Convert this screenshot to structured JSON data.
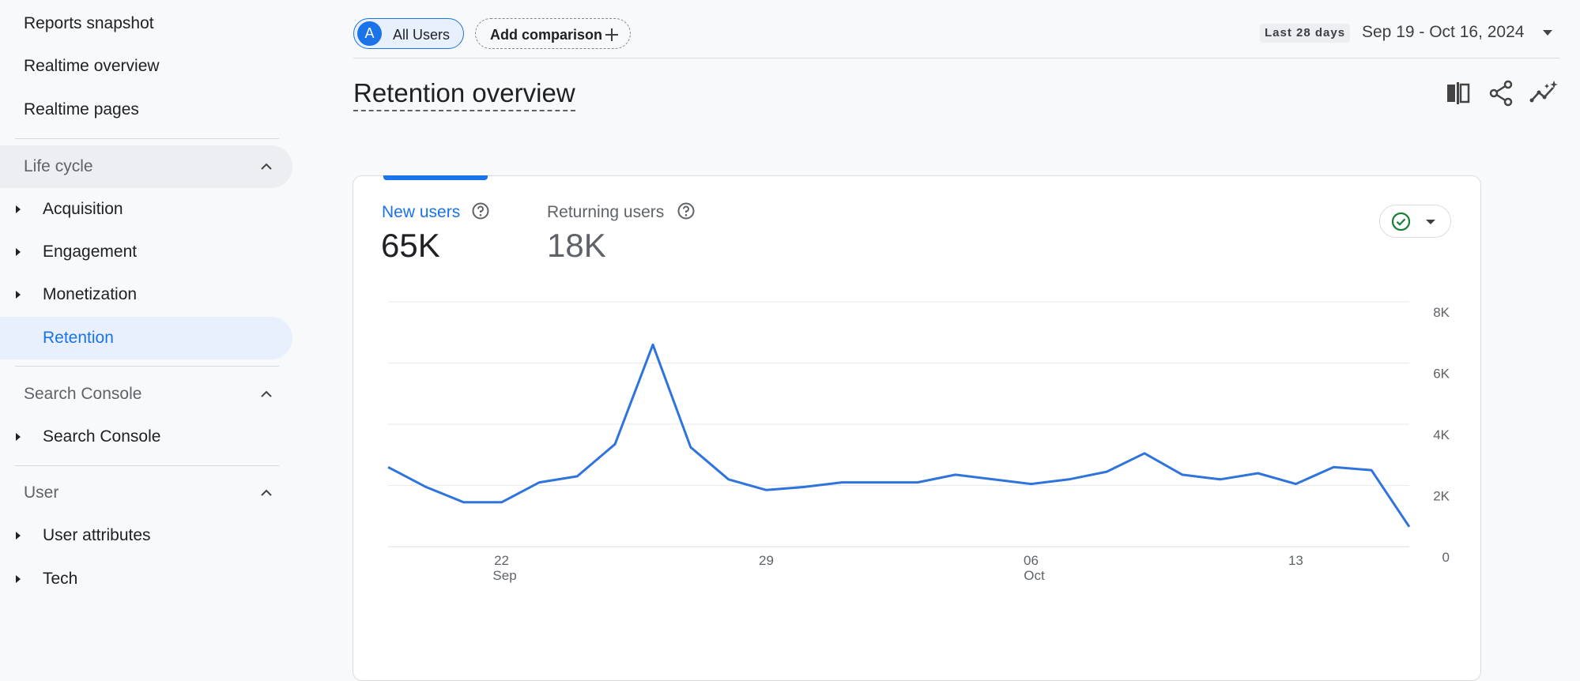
{
  "sidebar": {
    "top_items": [
      {
        "label": "Reports snapshot"
      },
      {
        "label": "Realtime overview"
      },
      {
        "label": "Realtime pages"
      }
    ],
    "sections": [
      {
        "title": "Life cycle",
        "items": [
          "Acquisition",
          "Engagement",
          "Monetization",
          "Retention"
        ],
        "active": "Retention"
      },
      {
        "title": "Search Console",
        "items": [
          "Search Console"
        ]
      },
      {
        "title": "User",
        "items": [
          "User attributes",
          "Tech"
        ]
      }
    ]
  },
  "header": {
    "segment_avatar": "A",
    "segment_label": "All Users",
    "compare_label": "Add comparison",
    "range_badge": "Last 28 days",
    "date_range": "Sep 19 - Oct 16, 2024"
  },
  "page_title": "Retention overview",
  "toolbar_icons": [
    "compare-view-icon",
    "share-icon",
    "insights-icon"
  ],
  "metrics": [
    {
      "label": "New users",
      "value": "65K",
      "active": true
    },
    {
      "label": "Returning users",
      "value": "18K",
      "active": false
    }
  ],
  "colors": {
    "accent": "#1a73e8",
    "line": "#2f74dd",
    "status_ok": "#188038"
  },
  "chart_data": {
    "type": "line",
    "x_start": "2024-09-19",
    "x": [
      "2024-09-19",
      "2024-09-20",
      "2024-09-21",
      "2024-09-22",
      "2024-09-23",
      "2024-09-24",
      "2024-09-25",
      "2024-09-26",
      "2024-09-27",
      "2024-09-28",
      "2024-09-29",
      "2024-09-30",
      "2024-10-01",
      "2024-10-02",
      "2024-10-03",
      "2024-10-04",
      "2024-10-05",
      "2024-10-06",
      "2024-10-07",
      "2024-10-08",
      "2024-10-09",
      "2024-10-10",
      "2024-10-11",
      "2024-10-12",
      "2024-10-13",
      "2024-10-14",
      "2024-10-15",
      "2024-10-16"
    ],
    "series": [
      {
        "name": "New users",
        "values": [
          2600,
          1950,
          1450,
          1450,
          2100,
          2300,
          3350,
          6600,
          3250,
          2200,
          1850,
          1950,
          2100,
          2100,
          2100,
          2350,
          2200,
          2050,
          2200,
          2450,
          3050,
          2350,
          2200,
          2400,
          2050,
          2600,
          2500,
          650
        ]
      }
    ],
    "y_ticks": [
      "8K",
      "6K",
      "4K",
      "2K",
      "0"
    ],
    "y_tick_values": [
      8000,
      6000,
      4000,
      2000,
      0
    ],
    "ylim": [
      0,
      8000
    ],
    "x_ticks": [
      {
        "day": "22",
        "month": "Sep",
        "date": "2024-09-22"
      },
      {
        "day": "29",
        "month": "",
        "date": "2024-09-29"
      },
      {
        "day": "06",
        "month": "Oct",
        "date": "2024-10-06"
      },
      {
        "day": "13",
        "month": "",
        "date": "2024-10-13"
      }
    ],
    "grid": true,
    "legend": "none"
  }
}
